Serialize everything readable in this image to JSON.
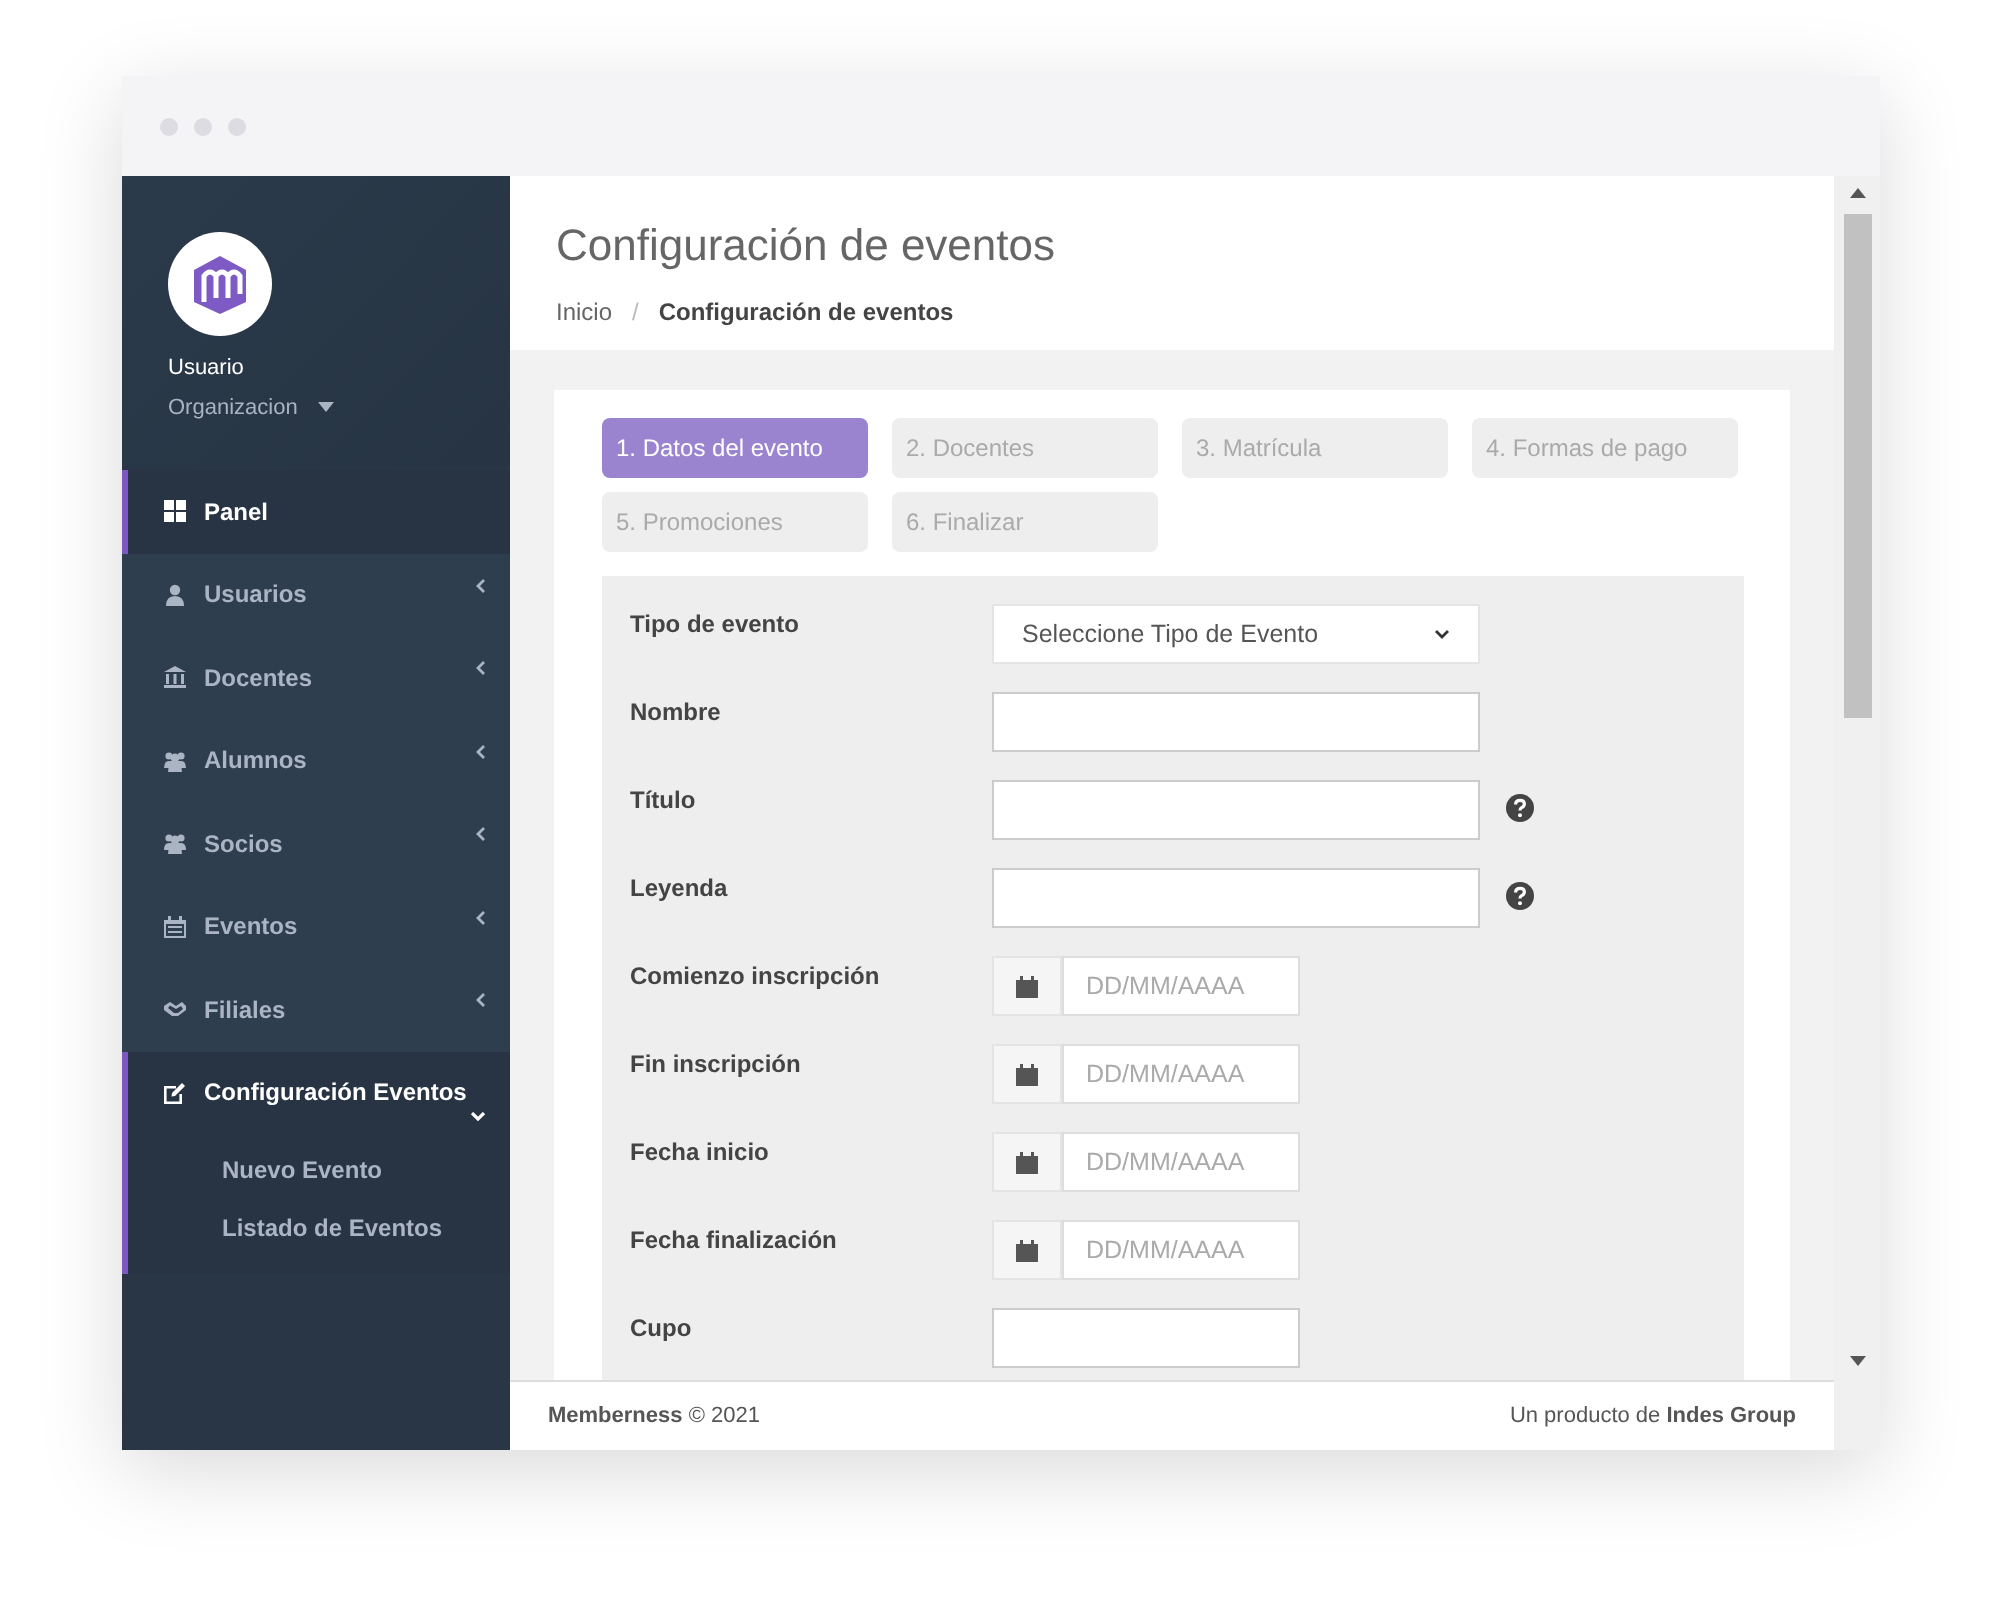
{
  "user": {
    "name": "Usuario",
    "organization": "Organizacion"
  },
  "menu": [
    {
      "label": "Panel",
      "selected": true,
      "kind": "link"
    },
    {
      "label": "Usuarios",
      "selected": false,
      "kind": "submenu",
      "expanded": false
    },
    {
      "label": "Docentes",
      "selected": false,
      "kind": "submenu",
      "expanded": false
    },
    {
      "label": "Alumnos",
      "selected": false,
      "kind": "submenu",
      "expanded": false
    },
    {
      "label": "Socios",
      "selected": false,
      "kind": "submenu",
      "expanded": false
    },
    {
      "label": "Eventos",
      "selected": false,
      "kind": "submenu",
      "expanded": false
    },
    {
      "label": "Filiales",
      "selected": false,
      "kind": "submenu",
      "expanded": false
    },
    {
      "label": "Configuración Eventos",
      "selected": true,
      "kind": "submenu",
      "expanded": true,
      "children": [
        {
          "label": "Nuevo Evento"
        },
        {
          "label": "Listado de Eventos"
        }
      ]
    }
  ],
  "page_title": "Configuración de eventos",
  "breadcrumb_separator": "/",
  "breadcrumb": [
    {
      "label": "Inicio",
      "current": false
    },
    {
      "label": "Configuración de eventos",
      "current": true
    }
  ],
  "steps": [
    {
      "label": "1. Datos del evento",
      "selected": true
    },
    {
      "label": "2. Docentes",
      "selected": false
    },
    {
      "label": "3. Matrícula",
      "selected": false
    },
    {
      "label": "4. Formas de pago",
      "selected": false
    },
    {
      "label": "5. Promociones",
      "selected": false
    },
    {
      "label": "6. Finalizar",
      "selected": false
    }
  ],
  "fields": [
    {
      "label": "Tipo de evento",
      "kind": "select",
      "value": "Seleccione Tipo de Evento"
    },
    {
      "label": "Nombre",
      "kind": "text"
    },
    {
      "label": "Título",
      "kind": "text",
      "help": true
    },
    {
      "label": "Leyenda",
      "kind": "text",
      "help": true
    },
    {
      "label": "Comienzo inscripción",
      "kind": "date",
      "placeholder": "DD/MM/AAAA"
    },
    {
      "label": "Fin inscripción",
      "kind": "date",
      "placeholder": "DD/MM/AAAA"
    },
    {
      "label": "Fecha inicio",
      "kind": "date",
      "placeholder": "DD/MM/AAAA"
    },
    {
      "label": "Fecha finalización",
      "kind": "date",
      "placeholder": "DD/MM/AAAA"
    },
    {
      "label": "Cupo",
      "kind": "short"
    }
  ],
  "footer": {
    "left": "**Memberness** © 2021",
    "right": "Un producto de **Indes Group**"
  }
}
